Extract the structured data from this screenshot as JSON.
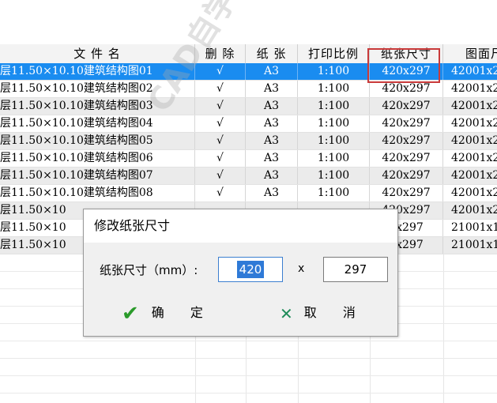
{
  "table": {
    "headers": [
      "文 件 名",
      "删 除",
      "纸 张",
      "打印比例",
      "纸张尺寸",
      "图面尺"
    ],
    "rows": [
      {
        "name": "层11.50×10.10建筑结构图01",
        "delete": "√",
        "paper": "A3",
        "scale": "1:100",
        "size": "420x297",
        "num": "42001x2",
        "selected": true
      },
      {
        "name": "层11.50×10.10建筑结构图02",
        "delete": "√",
        "paper": "A3",
        "scale": "1:100",
        "size": "420x297",
        "num": "42001x2",
        "selected": false
      },
      {
        "name": "层11.50×10.10建筑结构图03",
        "delete": "√",
        "paper": "A3",
        "scale": "1:100",
        "size": "420x297",
        "num": "42001x2",
        "selected": false
      },
      {
        "name": "层11.50×10.10建筑结构图04",
        "delete": "√",
        "paper": "A3",
        "scale": "1:100",
        "size": "420x297",
        "num": "42001x2",
        "selected": false
      },
      {
        "name": "层11.50×10.10建筑结构图05",
        "delete": "√",
        "paper": "A3",
        "scale": "1:100",
        "size": "420x297",
        "num": "42001x2",
        "selected": false
      },
      {
        "name": "层11.50×10.10建筑结构图06",
        "delete": "√",
        "paper": "A3",
        "scale": "1:100",
        "size": "420x297",
        "num": "42001x2",
        "selected": false
      },
      {
        "name": "层11.50×10.10建筑结构图07",
        "delete": "√",
        "paper": "A3",
        "scale": "1:100",
        "size": "420x297",
        "num": "42001x2",
        "selected": false
      },
      {
        "name": "层11.50×10.10建筑结构图08",
        "delete": "√",
        "paper": "A3",
        "scale": "1:100",
        "size": "420x297",
        "num": "42001x2",
        "selected": false
      },
      {
        "name": "层11.50×10",
        "delete": "",
        "paper": "",
        "scale": "",
        "size": "420x297",
        "num": "42001x2",
        "selected": false
      },
      {
        "name": "层11.50×10",
        "delete": "",
        "paper": "",
        "scale": "",
        "size": "0x297",
        "num": "21001x1",
        "selected": false
      },
      {
        "name": "层11.50×10",
        "delete": "",
        "paper": "",
        "scale": "",
        "size": "0x297",
        "num": "21001x1",
        "selected": false
      }
    ]
  },
  "dialog": {
    "title": "修改纸张尺寸",
    "size_label": "纸张尺寸（mm）:",
    "width_value": "420",
    "x_label": "x",
    "height_value": "297",
    "ok_label": "确 定",
    "cancel_label": "取 消"
  },
  "icons": {
    "ok": "check-icon",
    "cancel": "close-icon"
  },
  "colors": {
    "selection": "#1a8cf0",
    "highlight_box": "#c93a3a",
    "ok_icon": "#2a9a2a",
    "cancel_icon": "#1f8c5a"
  }
}
